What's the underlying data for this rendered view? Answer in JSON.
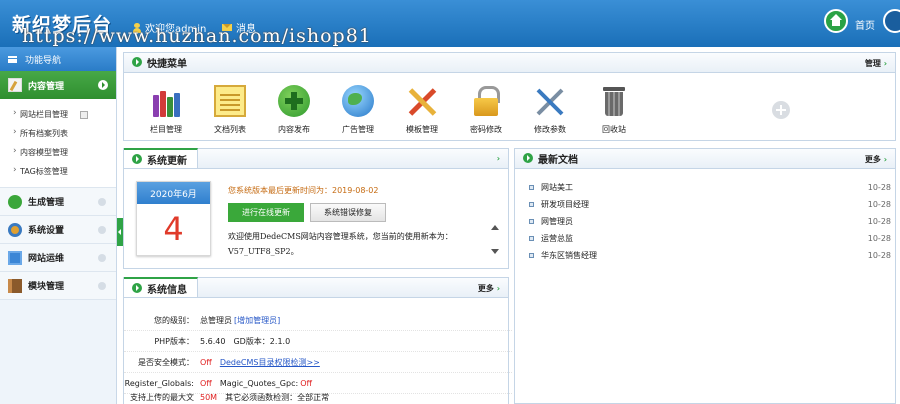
{
  "header": {
    "logo": "新织梦后台",
    "welcome": "欢迎您admin",
    "messages": "消息",
    "watermark": "https://www.huzhan.com/ishop81",
    "home_label": "首页"
  },
  "sidebar": {
    "title": "功能导航",
    "active_section": "内容管理",
    "sub_items": [
      "网站栏目管理",
      "所有档案列表",
      "内容模型管理",
      "TAG标签管理"
    ],
    "sections": [
      {
        "label": "生成管理",
        "icon": "tree-icon"
      },
      {
        "label": "系统设置",
        "icon": "gear-icon"
      },
      {
        "label": "网站运维",
        "icon": "monitor-icon"
      },
      {
        "label": "模块管理",
        "icon": "book-icon"
      }
    ]
  },
  "quick_menu": {
    "title": "快捷菜单",
    "manage_link": "管理",
    "items": [
      {
        "label": "栏目管理",
        "icon": "books-icon"
      },
      {
        "label": "文档列表",
        "icon": "notepad-icon"
      },
      {
        "label": "内容发布",
        "icon": "plus-circle-icon"
      },
      {
        "label": "广告管理",
        "icon": "globe-icon"
      },
      {
        "label": "模板管理",
        "icon": "tools-icon"
      },
      {
        "label": "密码修改",
        "icon": "lock-icon"
      },
      {
        "label": "修改参数",
        "icon": "wrench-icon"
      },
      {
        "label": "回收站",
        "icon": "trash-icon"
      }
    ]
  },
  "sys_update": {
    "title": "系统更新",
    "calendar_month": "2020年6月",
    "calendar_day": "4",
    "last_update": "您系统版本最后更新时间为：2019-08-02",
    "btn_online": "进行在线更新",
    "btn_fix": "系统错误修复",
    "text_line1": "欢迎使用DedeCMS网站内容管理系统，您当前的使用新本为：",
    "text_line2": "V57_UTF8_SP2。"
  },
  "latest_docs": {
    "title": "最新文档",
    "more": "更多",
    "items": [
      {
        "title": "网站美工",
        "date": "10-28"
      },
      {
        "title": "研发项目经理",
        "date": "10-28"
      },
      {
        "title": "网管理员",
        "date": "10-28"
      },
      {
        "title": "运营总监",
        "date": "10-28"
      },
      {
        "title": "华东区销售经理",
        "date": "10-28"
      }
    ]
  },
  "sys_info": {
    "title": "系统信息",
    "more": "更多",
    "rows": {
      "level_key": "您的级别：",
      "level_val": "总管理员",
      "add_admin": "[增加管理员]",
      "php_key": "PHP版本：",
      "php_val": "5.6.40",
      "gd_val": "GD版本：2.1.0",
      "safe_key": "是否安全模式：",
      "safe_val": "Off",
      "safe_link": "DedeCMS目录权限检测>>",
      "rg_key": "Register_Globals:",
      "rg_val": "Off",
      "mq_key": "Magic_Quotes_Gpc:",
      "mq_val": "Off",
      "upload_key": "支持上传的最大文",
      "upload_val": "50M",
      "upload_note": "其它必须函数检测：全部正常"
    }
  }
}
